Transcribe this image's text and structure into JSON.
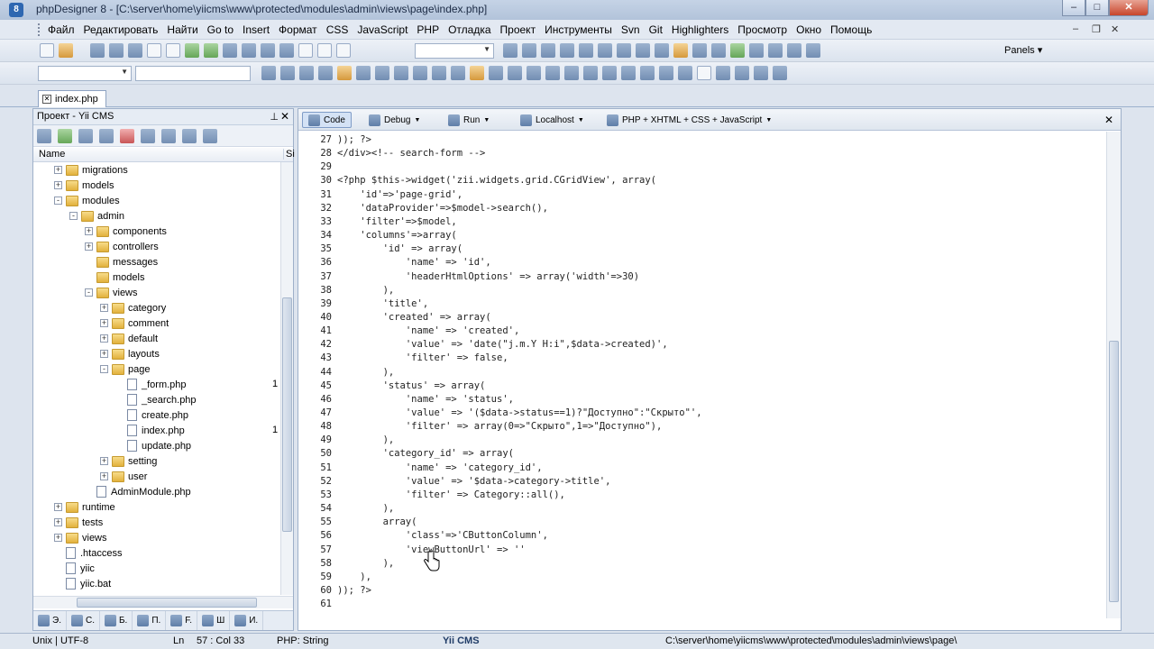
{
  "window": {
    "title": "phpDesigner 8 - [C:\\server\\home\\yiicms\\www\\protected\\modules\\admin\\views\\page\\index.php]"
  },
  "menu": [
    "Файл",
    "Редактировать",
    "Найти",
    "Go to",
    "Insert",
    "Формат",
    "CSS",
    "JavaScript",
    "PHP",
    "Отладка",
    "Проект",
    "Инструменты",
    "Svn",
    "Git",
    "Highlighters",
    "Просмотр",
    "Окно",
    "Помощь"
  ],
  "toolbar": {
    "panels_label": "Panels"
  },
  "file_tab": {
    "label": "index.php"
  },
  "project": {
    "title": "Проект - Yii CMS",
    "col_name": "Name",
    "col_size": "Si",
    "tree": [
      {
        "label": "migrations",
        "type": "folder",
        "depth": 4,
        "exp": "+"
      },
      {
        "label": "models",
        "type": "folder",
        "depth": 4,
        "exp": "+"
      },
      {
        "label": "modules",
        "type": "folder",
        "depth": 4,
        "exp": "-"
      },
      {
        "label": "admin",
        "type": "folder",
        "depth": 5,
        "exp": "-"
      },
      {
        "label": "components",
        "type": "folder",
        "depth": 6,
        "exp": "+"
      },
      {
        "label": "controllers",
        "type": "folder",
        "depth": 6,
        "exp": "+"
      },
      {
        "label": "messages",
        "type": "folder",
        "depth": 6,
        "exp": ""
      },
      {
        "label": "models",
        "type": "folder",
        "depth": 6,
        "exp": ""
      },
      {
        "label": "views",
        "type": "folder",
        "depth": 6,
        "exp": "-"
      },
      {
        "label": "category",
        "type": "folder",
        "depth": 7,
        "exp": "+"
      },
      {
        "label": "comment",
        "type": "folder",
        "depth": 7,
        "exp": "+"
      },
      {
        "label": "default",
        "type": "folder",
        "depth": 7,
        "exp": "+"
      },
      {
        "label": "layouts",
        "type": "folder",
        "depth": 7,
        "exp": "+"
      },
      {
        "label": "page",
        "type": "folder",
        "depth": 7,
        "exp": "-"
      },
      {
        "label": "_form.php",
        "type": "file",
        "depth": 8,
        "exp": "",
        "count": "1"
      },
      {
        "label": "_search.php",
        "type": "file",
        "depth": 8,
        "exp": ""
      },
      {
        "label": "create.php",
        "type": "file",
        "depth": 8,
        "exp": ""
      },
      {
        "label": "index.php",
        "type": "file",
        "depth": 8,
        "exp": "",
        "count": "1"
      },
      {
        "label": "update.php",
        "type": "file",
        "depth": 8,
        "exp": ""
      },
      {
        "label": "setting",
        "type": "folder",
        "depth": 7,
        "exp": "+"
      },
      {
        "label": "user",
        "type": "folder",
        "depth": 7,
        "exp": "+"
      },
      {
        "label": "AdminModule.php",
        "type": "file",
        "depth": 6,
        "exp": ""
      },
      {
        "label": "runtime",
        "type": "folder",
        "depth": 4,
        "exp": "+"
      },
      {
        "label": "tests",
        "type": "folder",
        "depth": 4,
        "exp": "+"
      },
      {
        "label": "views",
        "type": "folder",
        "depth": 4,
        "exp": "+"
      },
      {
        "label": ".htaccess",
        "type": "file",
        "depth": 4,
        "exp": ""
      },
      {
        "label": "yiic",
        "type": "file",
        "depth": 4,
        "exp": ""
      },
      {
        "label": "yiic.bat",
        "type": "file",
        "depth": 4,
        "exp": ""
      }
    ],
    "tabs": [
      "Э.",
      "С.",
      "Б.",
      "П.",
      "F.",
      "Ш",
      "И."
    ]
  },
  "editor": {
    "toolbar": [
      {
        "label": "Code",
        "icon": "code-icon"
      },
      {
        "label": "Debug",
        "icon": "debug-icon"
      },
      {
        "label": "Run",
        "icon": "run-icon"
      },
      {
        "label": "Localhost",
        "icon": "localhost-icon"
      },
      {
        "label": "PHP + XHTML + CSS + JavaScript",
        "icon": "highlighter-icon"
      }
    ],
    "lines": [
      {
        "n": "27",
        "t": ")); ?>"
      },
      {
        "n": "28",
        "t": "</div><!-- search-form -->"
      },
      {
        "n": "29",
        "t": ""
      },
      {
        "n": "30",
        "t": "<?php $this->widget('zii.widgets.grid.CGridView', array("
      },
      {
        "n": "31",
        "t": "    'id'=>'page-grid',"
      },
      {
        "n": "32",
        "t": "    'dataProvider'=>$model->search(),"
      },
      {
        "n": "33",
        "t": "    'filter'=>$model,"
      },
      {
        "n": "34",
        "t": "    'columns'=>array("
      },
      {
        "n": "35",
        "t": "        'id' => array("
      },
      {
        "n": "36",
        "t": "            'name' => 'id',"
      },
      {
        "n": "37",
        "t": "            'headerHtmlOptions' => array('width'=>30)"
      },
      {
        "n": "38",
        "t": "        ),"
      },
      {
        "n": "39",
        "t": "        'title',"
      },
      {
        "n": "40",
        "t": "        'created' => array("
      },
      {
        "n": "41",
        "t": "            'name' => 'created',"
      },
      {
        "n": "42",
        "t": "            'value' => 'date(\"j.m.Y H:i\",$data->created)',"
      },
      {
        "n": "43",
        "t": "            'filter' => false,"
      },
      {
        "n": "44",
        "t": "        ),"
      },
      {
        "n": "45",
        "t": "        'status' => array("
      },
      {
        "n": "46",
        "t": "            'name' => 'status',"
      },
      {
        "n": "47",
        "t": "            'value' => '($data->status==1)?\"Доступно\":\"Скрыто\"',"
      },
      {
        "n": "48",
        "t": "            'filter' => array(0=>\"Скрыто\",1=>\"Доступно\"),"
      },
      {
        "n": "49",
        "t": "        ),"
      },
      {
        "n": "50",
        "t": "        'category_id' => array("
      },
      {
        "n": "51",
        "t": "            'name' => 'category_id',"
      },
      {
        "n": "52",
        "t": "            'value' => '$data->category->title',"
      },
      {
        "n": "53",
        "t": "            'filter' => Category::all(),"
      },
      {
        "n": "54",
        "t": "        ),"
      },
      {
        "n": "55",
        "t": "        array("
      },
      {
        "n": "56",
        "t": "            'class'=>'CButtonColumn',"
      },
      {
        "n": "57",
        "t": "            'viewButtonUrl' => ''"
      },
      {
        "n": "58",
        "t": "        ),"
      },
      {
        "n": "59",
        "t": "    ),"
      },
      {
        "n": "60",
        "t": ")); ?>"
      },
      {
        "n": "61",
        "t": ""
      }
    ]
  },
  "status": {
    "encoding": "Unix | UTF-8",
    "ln_label": "Ln",
    "position": "57 : Col 33",
    "type": "PHP: String",
    "project": "Yii CMS",
    "path": "C:\\server\\home\\yiicms\\www\\protected\\modules\\admin\\views\\page\\"
  }
}
